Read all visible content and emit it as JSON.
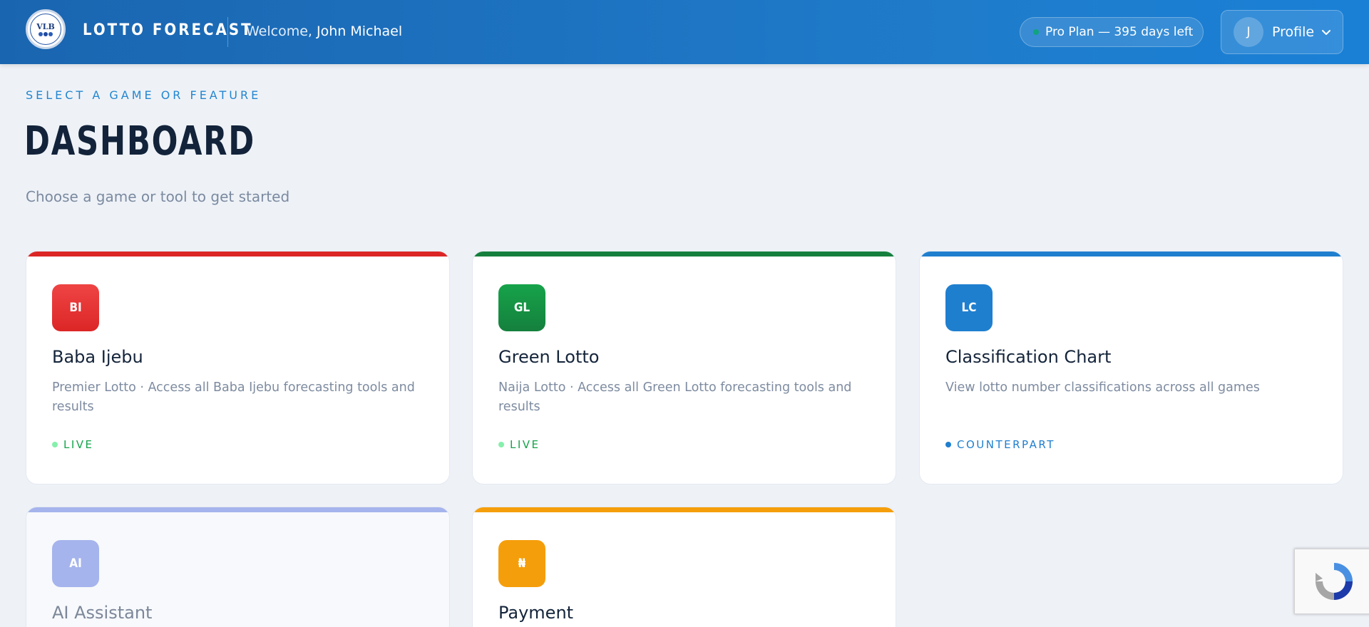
{
  "header": {
    "logo_text": "VLB",
    "brand": "LOTTO FORECAST",
    "welcome_prefix": "Welcome,",
    "user_name": "John Michael",
    "plan_label": "Pro Plan — 395 days left",
    "profile_initial": "J",
    "profile_label": "Profile"
  },
  "page": {
    "eyebrow": "SELECT A GAME OR FEATURE",
    "title": "DASHBOARD",
    "subtitle": "Choose a game or tool to get started"
  },
  "cards": [
    {
      "abbr": "BI",
      "title": "Baba Ijebu",
      "description": "Premier Lotto · Access all Baba Ijebu forecasting tools and results",
      "badge": "LIVE",
      "accent": "#dc2626",
      "icon_color": "#ef4444",
      "badge_color": "#16a34a",
      "badge_dot": "#86efac"
    },
    {
      "abbr": "GL",
      "title": "Green Lotto",
      "description": "Naija Lotto · Access all Green Lotto forecasting tools and results",
      "badge": "LIVE",
      "accent": "#15803d",
      "icon_color": "#16a34a",
      "badge_color": "#16a34a",
      "badge_dot": "#86efac"
    },
    {
      "abbr": "LC",
      "title": "Classification Chart",
      "description": "View lotto number classifications across all games",
      "badge": "COUNTERPART",
      "accent": "#1f7fcf",
      "icon_color": "#1f7fcf",
      "badge_color": "#1f7fcf",
      "badge_dot": "#1f7fcf"
    },
    {
      "abbr": "AI",
      "title": "AI Assistant",
      "accent": "#a5b4ec",
      "icon_color": "#a5b4ec"
    },
    {
      "abbr": "₦",
      "title": "Payment",
      "accent": "#f59e0b",
      "icon_color": "#f59e0b"
    }
  ]
}
